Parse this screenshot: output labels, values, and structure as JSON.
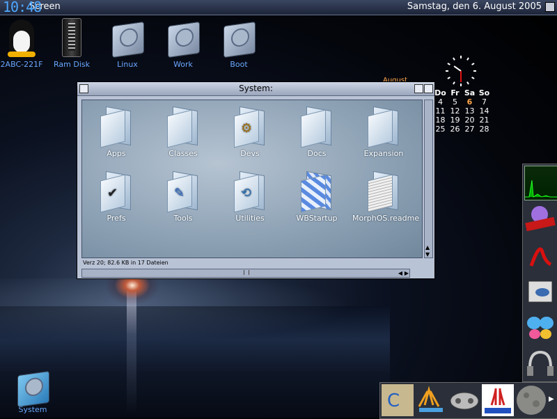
{
  "screen": {
    "clock": "10:48",
    "name": "Screen",
    "date": "Samstag, den  6. August 2005"
  },
  "desktop_icons": [
    {
      "label": "2ABC-221F",
      "icon": "linux-penguin-icon"
    },
    {
      "label": "Ram Disk",
      "icon": "ram-disk-icon"
    },
    {
      "label": "Linux",
      "icon": "hard-disk-icon"
    },
    {
      "label": "Work",
      "icon": "hard-disk-icon"
    },
    {
      "label": "Boot",
      "icon": "hard-disk-icon"
    }
  ],
  "trash_icon": {
    "label": "System",
    "icon": "system-disk-icon"
  },
  "window": {
    "title": "System:",
    "status": "Verz 20; 82.6 KB in 17 Dateien",
    "items": [
      {
        "label": "Apps",
        "icon": "folder-icon"
      },
      {
        "label": "Classes",
        "icon": "folder-icon"
      },
      {
        "label": "Devs",
        "icon": "folder-gears-icon"
      },
      {
        "label": "Docs",
        "icon": "folder-icon"
      },
      {
        "label": "Expansion",
        "icon": "folder-icon"
      },
      {
        "label": "Prefs",
        "icon": "folder-check-icon"
      },
      {
        "label": "Tools",
        "icon": "folder-tools-icon"
      },
      {
        "label": "Utilities",
        "icon": "folder-utilities-icon"
      },
      {
        "label": "WBStartup",
        "icon": "folder-wbstartup-icon"
      },
      {
        "label": "MorphOS.readme",
        "icon": "readme-document-icon"
      }
    ]
  },
  "calendar": {
    "month": "August",
    "headers": [
      "Do",
      "Fr",
      "Sa",
      "So"
    ],
    "rows": [
      [
        "4",
        "5",
        "6",
        "7"
      ],
      [
        "11",
        "12",
        "13",
        "14"
      ],
      [
        "18",
        "19",
        "20",
        "21"
      ],
      [
        "25",
        "26",
        "27",
        "28"
      ]
    ],
    "highlight": "6",
    "highlight_color": "#ffa64a"
  },
  "dock_right": [
    "cpu-monitor-icon",
    "voyager-browser-icon",
    "pdf-reader-icon",
    "video-player-icon",
    "butterfly-icon",
    "headphones-icon"
  ],
  "dock_bottom": [
    "commodore-icon",
    "atari-icon",
    "gamepad-icon",
    "atari-logo-icon",
    "moon-icon"
  ],
  "colors": {
    "accent": "#4fa8ff",
    "titlebar": "#1c2438",
    "window": "#b9c3d6"
  }
}
